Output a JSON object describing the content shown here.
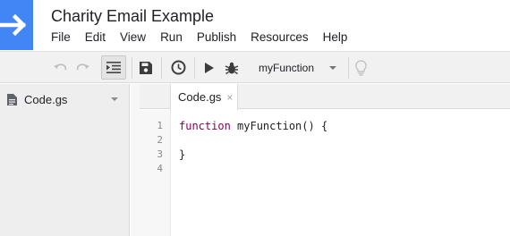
{
  "app": {
    "title": "Charity Email Example",
    "logo_icon": "arrow-right-icon",
    "brand_color": "#4285f4"
  },
  "menu": [
    "File",
    "Edit",
    "View",
    "Run",
    "Publish",
    "Resources",
    "Help"
  ],
  "toolbar": {
    "undo_icon": "undo-icon",
    "redo_icon": "redo-icon",
    "indent_icon": "indent-icon",
    "save_icon": "save-icon",
    "triggers_icon": "clock-icon",
    "run_icon": "play-icon",
    "debug_icon": "bug-icon",
    "function_select": "myFunction",
    "help_icon": "lightbulb-icon"
  },
  "sidebar": {
    "files": [
      {
        "name": "Code.gs"
      }
    ]
  },
  "editor": {
    "tabs": [
      {
        "label": "Code.gs",
        "close": "×"
      }
    ],
    "line_numbers": [
      "1",
      "2",
      "3",
      "4"
    ],
    "code": {
      "keyword": "function",
      "rest": " myFunction() {",
      "line2": "",
      "line3": "}",
      "line4": ""
    },
    "keyword_color": "#7f0055"
  }
}
